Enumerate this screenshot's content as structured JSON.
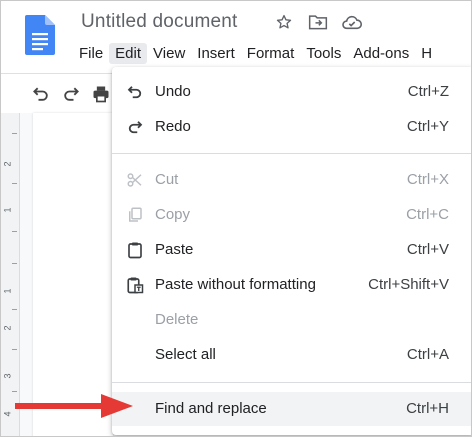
{
  "document": {
    "title": "Untitled document"
  },
  "menubar": [
    "File",
    "Edit",
    "View",
    "Insert",
    "Format",
    "Tools",
    "Add-ons"
  ],
  "menubar_overflow": "H",
  "ruler": {
    "labels": [
      "2",
      "1",
      "1",
      "2",
      "3",
      "4"
    ]
  },
  "edit_menu": {
    "items": [
      {
        "label": "Undo",
        "shortcut": "Ctrl+Z",
        "icon": "undo-icon",
        "disabled": false
      },
      {
        "label": "Redo",
        "shortcut": "Ctrl+Y",
        "icon": "redo-icon",
        "disabled": false
      },
      {
        "label": "Cut",
        "shortcut": "Ctrl+X",
        "icon": "scissors-icon",
        "disabled": true
      },
      {
        "label": "Copy",
        "shortcut": "Ctrl+C",
        "icon": "copy-icon",
        "disabled": true
      },
      {
        "label": "Paste",
        "shortcut": "Ctrl+V",
        "icon": "clipboard-icon",
        "disabled": false
      },
      {
        "label": "Paste without formatting",
        "shortcut": "Ctrl+Shift+V",
        "icon": "paste-plain-icon",
        "disabled": false
      },
      {
        "label": "Delete",
        "shortcut": "",
        "icon": "",
        "disabled": true
      },
      {
        "label": "Select all",
        "shortcut": "Ctrl+A",
        "icon": "",
        "disabled": false
      },
      {
        "label": "Find and replace",
        "shortcut": "Ctrl+H",
        "icon": "",
        "disabled": false
      }
    ]
  },
  "colors": {
    "brand": "#4285f4",
    "arrow": "#e53935",
    "text": "#202124",
    "disabled": "#9aa0a6"
  }
}
